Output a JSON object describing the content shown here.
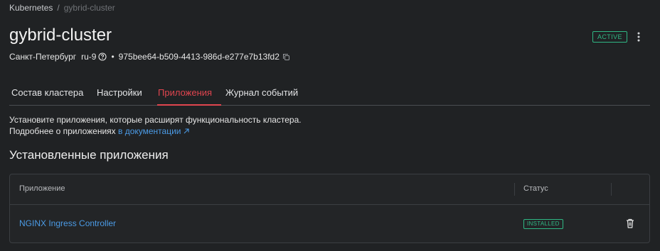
{
  "breadcrumb": {
    "root": "Kubernetes",
    "separator": "/",
    "current": "gybrid-cluster"
  },
  "cluster": {
    "name": "gybrid-cluster",
    "status": "ACTIVE",
    "city": "Санкт-Петербург",
    "region": "ru-9",
    "separator": "•",
    "id": "975bee64-b509-4413-986d-e277e7b13fd2"
  },
  "tabs": [
    {
      "label": "Состав кластера",
      "active": false
    },
    {
      "label": "Настройки",
      "active": false
    },
    {
      "label": "Приложения",
      "active": true
    },
    {
      "label": "Журнал событий",
      "active": false
    }
  ],
  "info": {
    "line1": "Установите приложения, которые расширят функциональность кластера.",
    "line2_text": "Подробнее о приложениях",
    "line2_link": "в документации"
  },
  "installed": {
    "title": "Установленные приложения",
    "columns": {
      "app": "Приложение",
      "status": "Статус"
    },
    "rows": [
      {
        "name": "NGINX Ingress Controller",
        "status": "INSTALLED"
      }
    ]
  },
  "icons": {
    "more": "more-vertical-icon",
    "help": "help-circle-icon",
    "copy": "copy-icon",
    "external": "external-link-icon",
    "delete": "trash-icon"
  },
  "colors": {
    "background": "#202224",
    "accent_red": "#e0454f",
    "link_blue": "#4b9be6",
    "status_green": "#2fb884"
  }
}
